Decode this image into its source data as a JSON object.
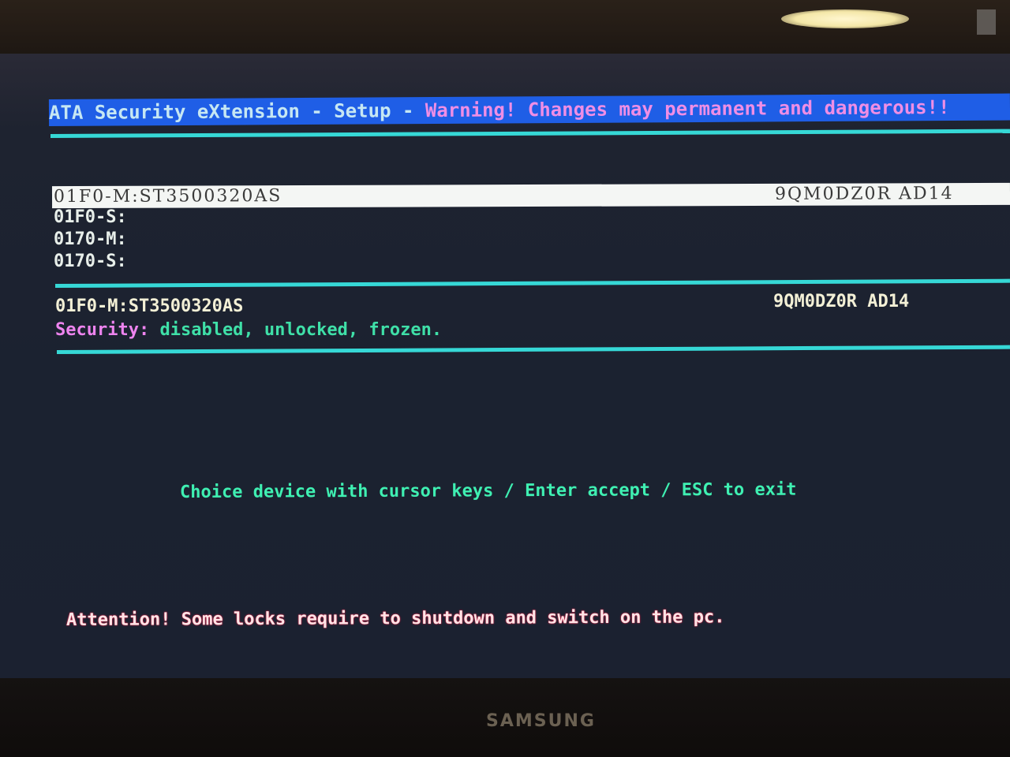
{
  "header": {
    "title": "ATA Security eXtension - Setup - ",
    "warning": "Warning! Changes may permanent and dangerous!!"
  },
  "devices": [
    {
      "label": "01F0-M:ST3500320AS",
      "serial": "9QM0DZ0R AD14",
      "selected": true
    },
    {
      "label": "01F0-S:",
      "serial": "",
      "selected": false
    },
    {
      "label": "0170-M:",
      "serial": "",
      "selected": false
    },
    {
      "label": "0170-S:",
      "serial": "",
      "selected": false
    }
  ],
  "detail": {
    "model": "01F0-M:ST3500320AS",
    "serial": "9QM0DZ0R AD14",
    "security_label": "Security:",
    "security_value": "disabled, unlocked, frozen."
  },
  "help": "Choice device with cursor keys / Enter accept / ESC to exit",
  "attention": "Attention! Some locks require to shutdown and switch on the pc.",
  "monitor": {
    "brand": "SAMSUNG"
  },
  "colors": {
    "title_bar_bg": "#1f5ee6",
    "title_text": "#c6e7f3",
    "warning_text": "#ef8ee5",
    "divider": "#36d8d6",
    "selected_row_bg": "#f4f6f4",
    "security_label": "#ee84ef",
    "security_value": "#3fe0a8",
    "help_text": "#3ff0b2",
    "attention_text": "#ff3050"
  }
}
